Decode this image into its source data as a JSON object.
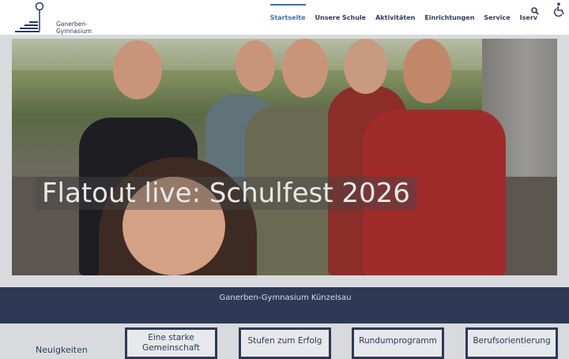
{
  "logo": {
    "line1": "Ganerben-",
    "line2": "Gymnasium"
  },
  "nav": {
    "items": [
      "Startseite",
      "Unsere Schule",
      "Aktivitäten",
      "Einrichtungen",
      "Service",
      "Iserv"
    ],
    "active": "Startseite"
  },
  "hero": {
    "title": "Flatout live: Schulfest 2026"
  },
  "band": {
    "text": "Ganerben-Gymnasium Künzelsau"
  },
  "bottom": {
    "news_label": "Neuigkeiten",
    "tiles": [
      "Eine starke Gemeinschaft",
      "Stufen zum Erfolg",
      "Rundumprogramm",
      "Berufsorientierung"
    ]
  },
  "colors": {
    "navy": "#2e3a55",
    "accent": "#3e6da8",
    "text": "#2d3a58"
  },
  "icons": {
    "search": "search-icon",
    "accessibility": "accessibility-icon"
  }
}
